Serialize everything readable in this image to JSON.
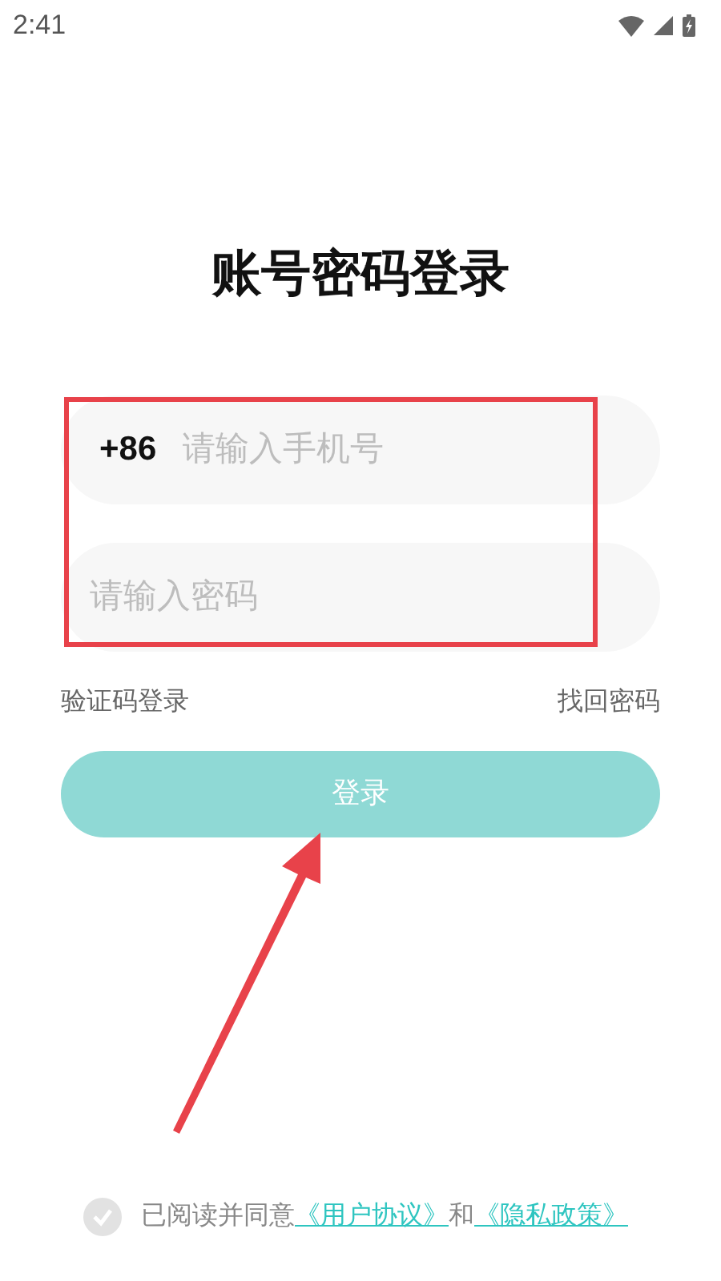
{
  "status_bar": {
    "time": "2:41"
  },
  "title": "账号密码登录",
  "phone_field": {
    "prefix": "+86",
    "placeholder": "请输入手机号"
  },
  "password_field": {
    "placeholder": "请输入密码"
  },
  "links": [
    "验证码登录",
    "找回密码"
  ],
  "login_button": {
    "label": "登录",
    "disabled": true
  },
  "agreement": {
    "checked": false,
    "text": "已阅读并同意",
    "links": [
      "《用户协议》",
      "《隐私政策》"
    ],
    "joiner": "和"
  }
}
